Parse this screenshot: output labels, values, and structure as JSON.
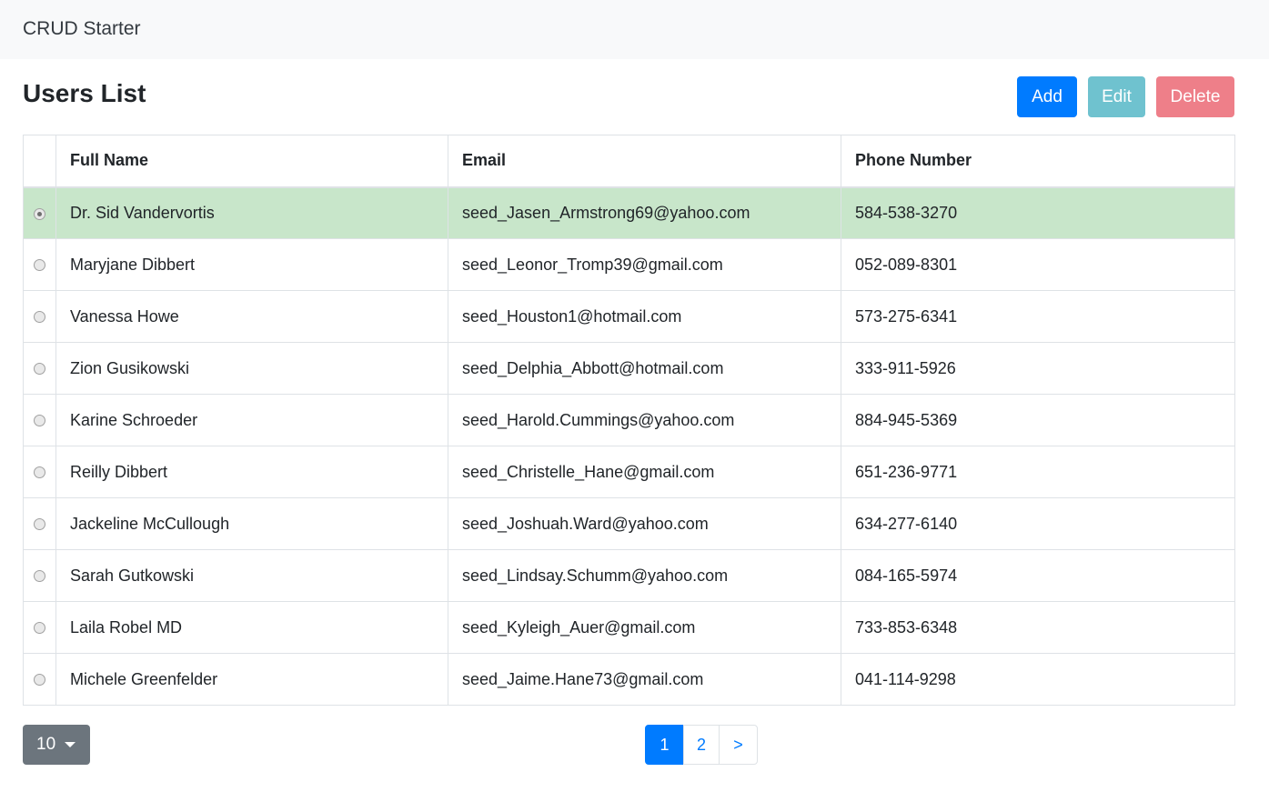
{
  "navbar": {
    "brand": "CRUD Starter"
  },
  "page": {
    "title": "Users List"
  },
  "toolbar": {
    "add_label": "Add",
    "edit_label": "Edit",
    "delete_label": "Delete"
  },
  "table": {
    "headers": {
      "name": "Full Name",
      "email": "Email",
      "phone": "Phone Number"
    },
    "rows": [
      {
        "name": "Dr. Sid Vandervortis",
        "email": "seed_Jasen_Armstrong69@yahoo.com",
        "phone": "584-538-3270",
        "selected": true
      },
      {
        "name": "Maryjane Dibbert",
        "email": "seed_Leonor_Tromp39@gmail.com",
        "phone": "052-089-8301",
        "selected": false
      },
      {
        "name": "Vanessa Howe",
        "email": "seed_Houston1@hotmail.com",
        "phone": "573-275-6341",
        "selected": false
      },
      {
        "name": "Zion Gusikowski",
        "email": "seed_Delphia_Abbott@hotmail.com",
        "phone": "333-911-5926",
        "selected": false
      },
      {
        "name": "Karine Schroeder",
        "email": "seed_Harold.Cummings@yahoo.com",
        "phone": "884-945-5369",
        "selected": false
      },
      {
        "name": "Reilly Dibbert",
        "email": "seed_Christelle_Hane@gmail.com",
        "phone": "651-236-9771",
        "selected": false
      },
      {
        "name": "Jackeline McCullough",
        "email": "seed_Joshuah.Ward@yahoo.com",
        "phone": "634-277-6140",
        "selected": false
      },
      {
        "name": "Sarah Gutkowski",
        "email": "seed_Lindsay.Schumm@yahoo.com",
        "phone": "084-165-5974",
        "selected": false
      },
      {
        "name": "Laila Robel MD",
        "email": "seed_Kyleigh_Auer@gmail.com",
        "phone": "733-853-6348",
        "selected": false
      },
      {
        "name": "Michele Greenfelder",
        "email": "seed_Jaime.Hane73@gmail.com",
        "phone": "041-114-9298",
        "selected": false
      }
    ]
  },
  "footer": {
    "page_size": "10",
    "pagination": {
      "pages": [
        "1",
        "2"
      ],
      "current": "1",
      "next": ">"
    }
  },
  "colors": {
    "primary": "#007bff",
    "info": "#6fc2cf",
    "danger": "#ee7f89",
    "secondary": "#6c757d",
    "selected_row": "#c8e6ca"
  }
}
